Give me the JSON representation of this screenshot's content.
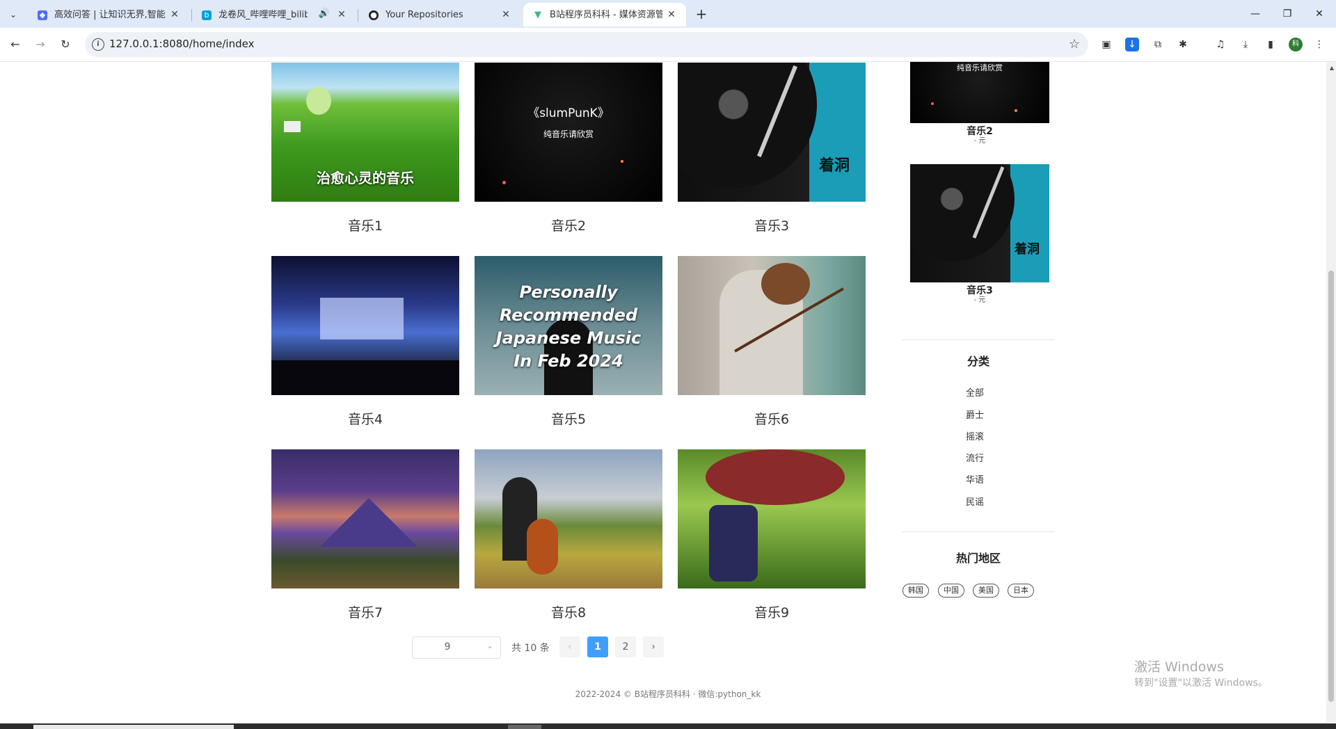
{
  "browser": {
    "tabs": [
      {
        "title": "高效问答 | 让知识无界,智能触手可及",
        "favicon": "deepseek-icon",
        "active": false
      },
      {
        "title": "龙卷风_哔哩哔哩_bilibili",
        "favicon": "bilibili-icon",
        "active": false,
        "audio": true
      },
      {
        "title": "Your Repositories",
        "favicon": "github-icon",
        "active": false
      },
      {
        "title": "B站程序员科科 - 媒体资源管理",
        "favicon": "vue-icon",
        "active": true
      }
    ],
    "url": "127.0.0.1:8080/home/index",
    "profile_initial": "科"
  },
  "grid": {
    "items": [
      {
        "label": "音乐1",
        "image_text": "治愈心灵的音乐"
      },
      {
        "label": "音乐2",
        "image_text": "《slumPunK》",
        "image_subtext": "纯音乐请欣赏"
      },
      {
        "label": "音乐3",
        "image_text": "着洞"
      },
      {
        "label": "音乐4"
      },
      {
        "label": "音乐5",
        "image_text_lines": [
          "Personally",
          "Recommended",
          "Japanese Music",
          "In Feb 2024"
        ]
      },
      {
        "label": "音乐6"
      },
      {
        "label": "音乐7"
      },
      {
        "label": "音乐8"
      },
      {
        "label": "音乐9"
      }
    ]
  },
  "sidebar": {
    "recommend": [
      {
        "name": "音乐2",
        "price": "- 元",
        "image_text": "纯音乐请欣赏"
      },
      {
        "name": "音乐3",
        "price": "- 元",
        "image_text": "着洞"
      }
    ],
    "category_title": "分类",
    "categories": [
      "全部",
      "爵士",
      "摇滚",
      "流行",
      "华语",
      "民谣"
    ],
    "region_title": "热门地区",
    "regions": [
      "韩国",
      "中国",
      "美国",
      "日本"
    ]
  },
  "pagination": {
    "page_size": "9",
    "total_text": "共 10 条",
    "pages": [
      "1",
      "2"
    ],
    "current": "1",
    "prev": "‹",
    "next": "›"
  },
  "footer": "2022-2024 © B站程序员科科 · 微信:python_kk",
  "watermark": {
    "line1": "激活 Windows",
    "line2": "转到\"设置\"以激活 Windows。"
  }
}
